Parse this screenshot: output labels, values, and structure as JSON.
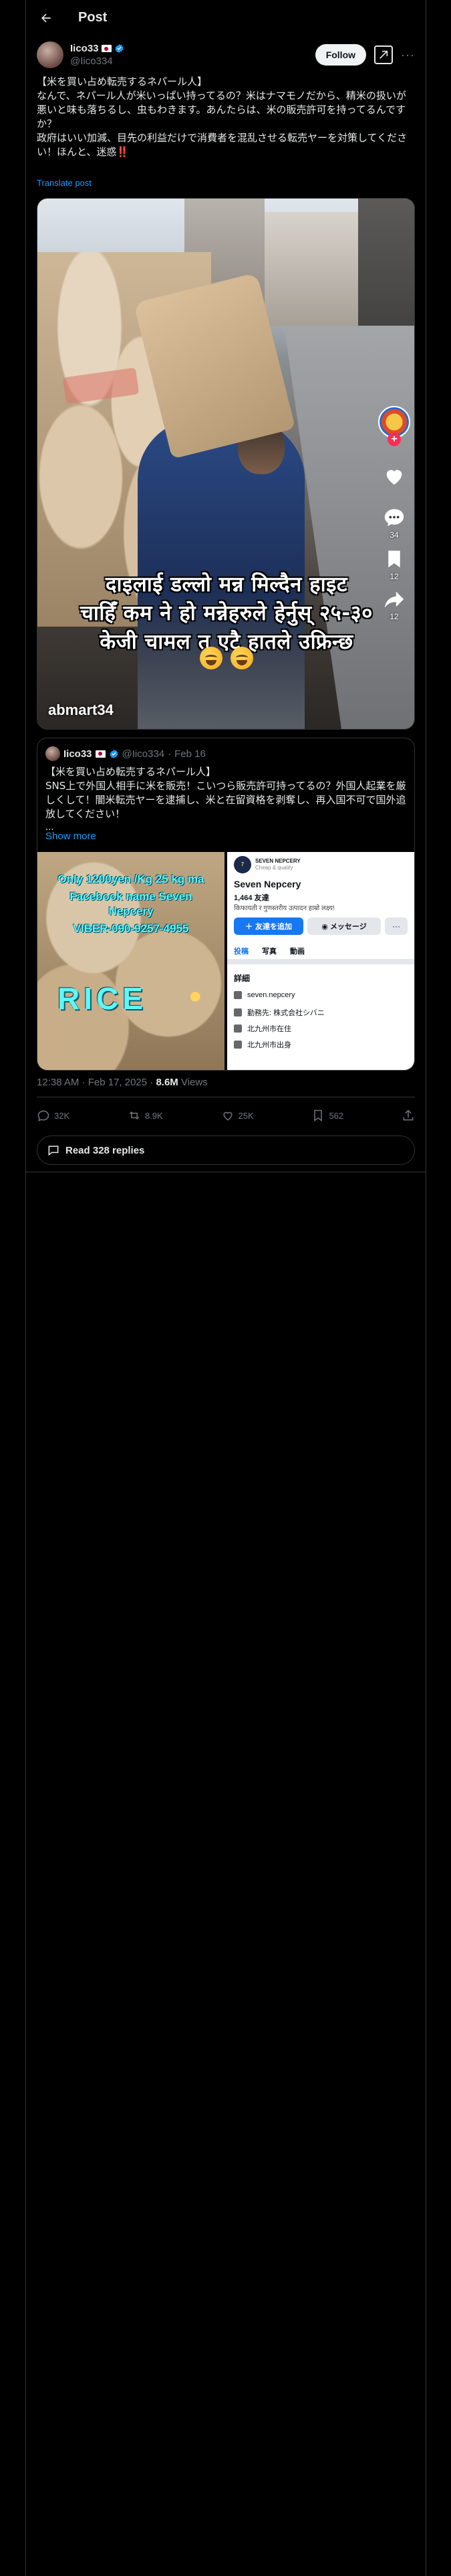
{
  "topbar": {
    "title": "Post"
  },
  "author": {
    "name": "Iico33",
    "handle": "@Iico334",
    "follow_label": "Follow",
    "grok_label": "x"
  },
  "post": {
    "lines": [
      "【米を買い占め転売するネパール人】",
      "なんで、ネパール人が米いっぱい持ってるの？米はナマモノだから、精米の扱いが悪いと味も落ちるし、虫もわきます。あんたらは、米の販売許可を持ってるんですか？",
      "政府はいい加減、目先の利益だけで消費者を混乱させる転売ヤーを対策してください！ほんと、迷惑"
    ],
    "bang": "‼️",
    "translate": "Translate post"
  },
  "video": {
    "caption_line1": "दाइलाई डल्लो मन्न मिल्दैन हाइट",
    "caption_line2": "चाहिँ कम ने हो मन्नेहरुले हेर्नुस् २५-३०",
    "caption_line3": "केजी चामल त एटै हातले उफ्रिन्छ",
    "watermark": "abmart34",
    "rail": {
      "likes": "",
      "comments": "34",
      "bookmarks": "12",
      "shares": "12"
    }
  },
  "quote": {
    "name": "Iico33",
    "handle": "@Iico334",
    "date": "Feb 16",
    "text_lines": [
      "【米を買い占め転売するネパール人】",
      "SNS上で外国人相手に米を販売！こいつら販売許可持ってるの？外国人起業を厳しくして！闇米転売ヤーを逮捕し、米と在留資格を剥奪し、再入国不可で国外追放してください！"
    ],
    "ellipsis": "...",
    "show_more": "Show more",
    "img1": {
      "line1": "Only 1200yen /Kg 25 kg ma",
      "line2": "Facebook name Seven",
      "line3": "Nepcery",
      "line4": "VIBER-090-9257-4955",
      "rice": "RICE"
    },
    "img2": {
      "logo_text": "SEVEN NEPCERY",
      "logo_sub": "Cheap & quality",
      "page_name": "Seven Nepcery",
      "friends": "1,464 友達",
      "subtitle": "किफायती र गुणस्तरीय उत्पादन हाम्रो लक्ष्य!",
      "add_friend": "友達を追加",
      "message": "メッセージ",
      "more": "···",
      "tabs": [
        "投稿",
        "写真",
        "動画"
      ],
      "section": "詳細",
      "rows": [
        "seven.nepcery",
        "勤務先: 株式会社シバニ",
        "北九州市在住",
        "北九州市出身"
      ]
    }
  },
  "meta": {
    "time": "12:38 AM · Feb 17, 2025 · ",
    "views_count": "8.6M",
    "views_label": " Views"
  },
  "actions": {
    "replies": "32K",
    "reposts": "8.9K",
    "likes": "25K",
    "bookmarks": "562"
  },
  "read_replies": "Read 328 replies",
  "colors": {
    "accent": "#1d9bf0",
    "text": "#e7e9ea",
    "muted": "#71767b",
    "border": "#2f3336",
    "bg": "#000000"
  },
  "icons": [
    "back-arrow-icon",
    "verified-badge-icon",
    "grok-icon",
    "heart-icon",
    "comment-icon",
    "bookmark-icon",
    "share-icon",
    "reply-icon",
    "repost-icon",
    "like-icon",
    "bookmark-icon",
    "upload-icon",
    "chat-bubble-icon"
  ]
}
